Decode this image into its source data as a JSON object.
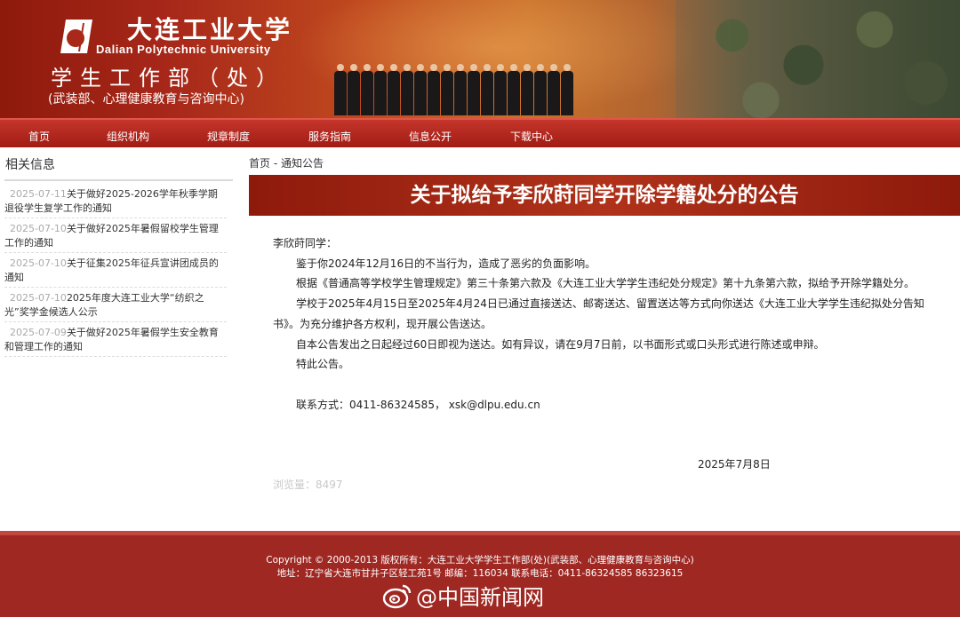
{
  "header": {
    "university_cn": "大连工业大学",
    "university_en": "Dalian Polytechnic University",
    "dept_title": "学生工作部（处）",
    "dept_subtitle": "(武装部、心理健康教育与咨询中心)",
    "brand_color": "#a11c15"
  },
  "nav": {
    "items": [
      {
        "label": "首页"
      },
      {
        "label": "组织机构"
      },
      {
        "label": "规章制度"
      },
      {
        "label": "服务指南"
      },
      {
        "label": "信息公开"
      },
      {
        "label": "下载中心"
      }
    ]
  },
  "sidebar": {
    "title": "相关信息",
    "items": [
      {
        "date": "2025-07-11",
        "title": "关于做好2025-2026学年秋季学期退役学生复学工作的通知"
      },
      {
        "date": "2025-07-10",
        "title": "关于做好2025年暑假留校学生管理工作的通知"
      },
      {
        "date": "2025-07-10",
        "title": "关于征集2025年征兵宣讲团成员的通知"
      },
      {
        "date": "2025-07-10",
        "title": "2025年度大连工业大学“纺织之光”奖学金候选人公示"
      },
      {
        "date": "2025-07-09",
        "title": "关于做好2025年暑假学生安全教育和管理工作的通知"
      }
    ]
  },
  "breadcrumb": {
    "home": "首页",
    "separator": " - ",
    "current": "通知公告"
  },
  "notice": {
    "title": "关于拟给予李欣莳同学开除学籍处分的公告",
    "salutation": "李欣莳同学：",
    "paragraphs": [
      "鉴于你2024年12月16日的不当行为，造成了恶劣的负面影响。",
      "根据《普通高等学校学生管理规定》第三十条第六款及《大连工业大学学生违纪处分规定》第十九条第六款，拟给予开除学籍处分。",
      "学校于2025年4月15日至2025年4月24日已通过直接送达、邮寄送达、留置送达等方式向你送达《大连工业大学学生违纪拟处分告知书》。为充分维护各方权利，现开展公告送达。",
      "自本公告发出之日起经过60日即视为送达。如有异议，请在9月7日前，以书面形式或口头形式进行陈述或申辩。",
      "特此公告。"
    ],
    "contact": "联系方式：0411-86324585， xsk@dlpu.edu.cn",
    "date": "2025年7月8日",
    "views_label": "浏览量：",
    "views": "8497"
  },
  "footer": {
    "copyright": "Copyright © 2000-2013 版权所有：大连工业大学学生工作部(处)(武装部、心理健康教育与咨询中心)",
    "address": "地址：辽宁省大连市甘井子区轻工苑1号 邮编：116034 联系电话：0411-86324585 86323615"
  },
  "watermark": {
    "text": "@中国新闻网",
    "icon": "weibo-icon"
  }
}
